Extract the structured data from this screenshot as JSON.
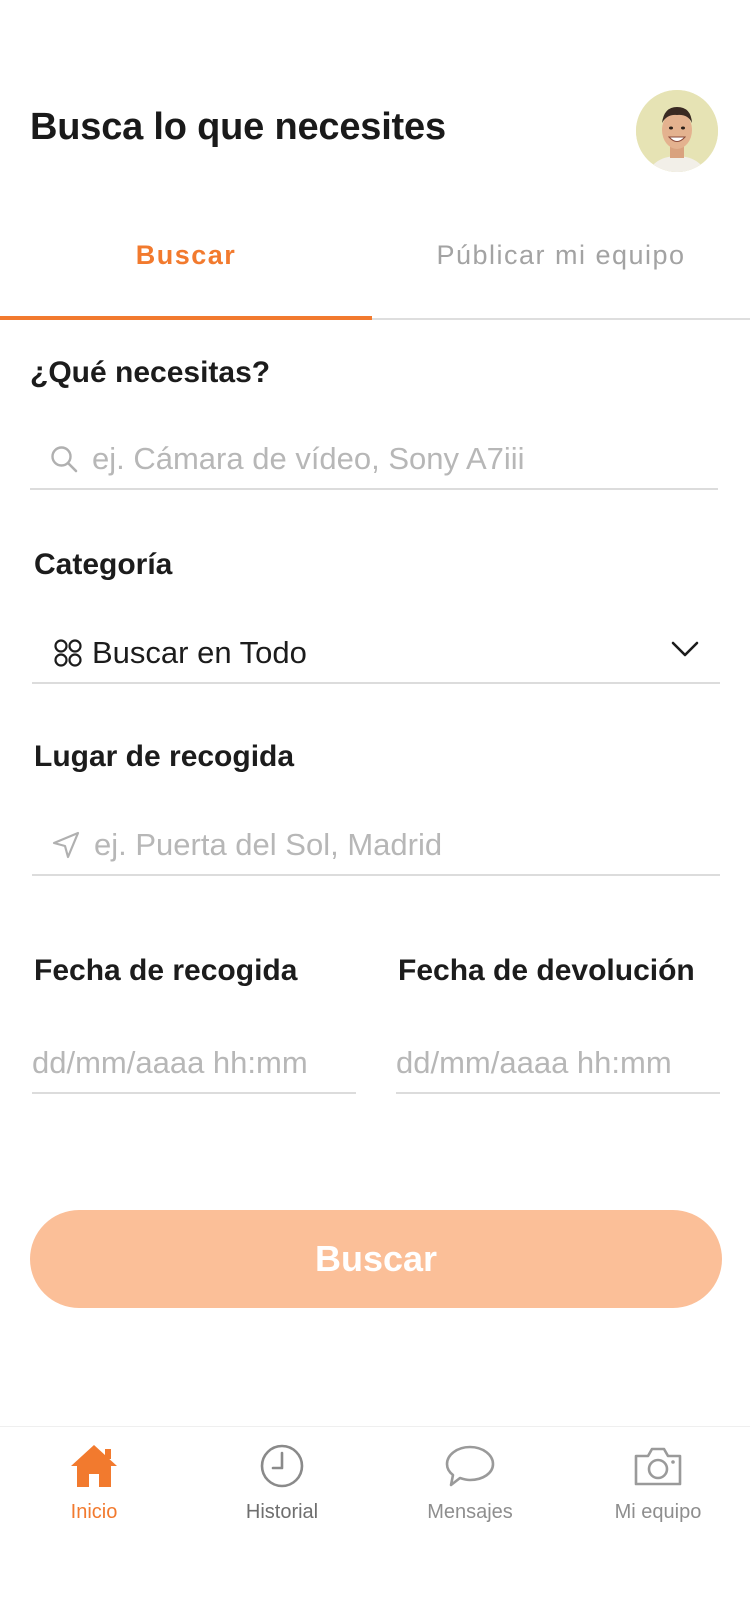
{
  "header": {
    "title": "Busca lo que necesites"
  },
  "tabs": [
    {
      "label": "Buscar",
      "active": true
    },
    {
      "label": "Públicar mi equipo",
      "active": false
    }
  ],
  "form": {
    "what_label": "¿Qué necesitas?",
    "what_placeholder": "ej. Cámara de vídeo, Sony A7iii",
    "category_label": "Categoría",
    "category_value": "Buscar en Todo",
    "pickup_place_label": "Lugar de recogida",
    "pickup_place_placeholder": "ej. Puerta del Sol, Madrid",
    "pickup_date_label": "Fecha de recogida",
    "pickup_date_placeholder": "dd/mm/aaaa hh:mm",
    "return_date_label": "Fecha de devolución",
    "return_date_placeholder": "dd/mm/aaaa hh:mm",
    "submit_label": "Buscar"
  },
  "bottom_nav": [
    {
      "label": "Inicio",
      "icon": "home-icon",
      "active": true
    },
    {
      "label": "Historial",
      "icon": "clock-icon",
      "active": false
    },
    {
      "label": "Mensajes",
      "icon": "chat-bubble-icon",
      "active": false
    },
    {
      "label": "Mi equipo",
      "icon": "camera-icon",
      "active": false
    }
  ],
  "colors": {
    "accent": "#f27a2e",
    "button_disabled": "#fbbf98",
    "placeholder": "#b7b7b7",
    "divider": "#dcdcdc"
  }
}
